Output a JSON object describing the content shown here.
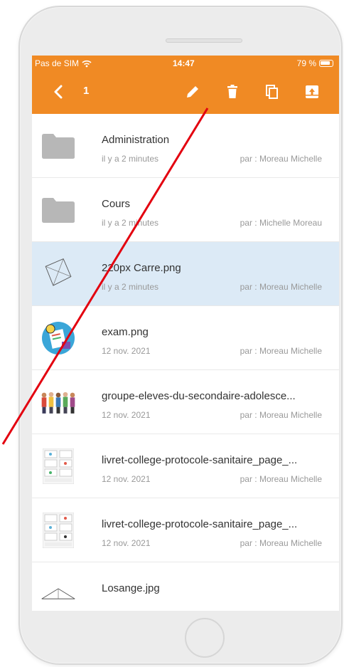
{
  "status": {
    "carrier": "Pas de SIM",
    "time": "14:47",
    "battery": "79 %"
  },
  "toolbar": {
    "count": "1",
    "icons": [
      "back-icon",
      "edit-icon",
      "trash-icon",
      "copy-icon",
      "archive-icon"
    ]
  },
  "files": [
    {
      "name": "Administration",
      "date": "il y a 2 minutes",
      "author": "par : Moreau Michelle",
      "type": "folder"
    },
    {
      "name": "Cours",
      "date": "il y a 2 minutes",
      "author": "par : Michelle Moreau",
      "type": "folder"
    },
    {
      "name": "220px Carre.png",
      "date": "il y a 2 minutes",
      "author": "par : Moreau Michelle",
      "type": "square-image",
      "selected": true
    },
    {
      "name": "exam.png",
      "date": "12 nov. 2021",
      "author": "par : Moreau Michelle",
      "type": "exam-image"
    },
    {
      "name": "groupe-eleves-du-secondaire-adolesce...",
      "date": "12 nov. 2021",
      "author": "par : Moreau Michelle",
      "type": "group-image"
    },
    {
      "name": "livret-college-protocole-sanitaire_page_...",
      "date": "12 nov. 2021",
      "author": "par : Moreau Michelle",
      "type": "booklet-image"
    },
    {
      "name": "livret-college-protocole-sanitaire_page_...",
      "date": "12 nov. 2021",
      "author": "par : Moreau Michelle",
      "type": "booklet-image"
    },
    {
      "name": "Losange.jpg",
      "date": "",
      "author": "",
      "type": "rhombus-image"
    }
  ],
  "colors": {
    "accent": "#f08a24",
    "selected_row": "#dceaf6",
    "annotation_line": "#e3000f"
  }
}
